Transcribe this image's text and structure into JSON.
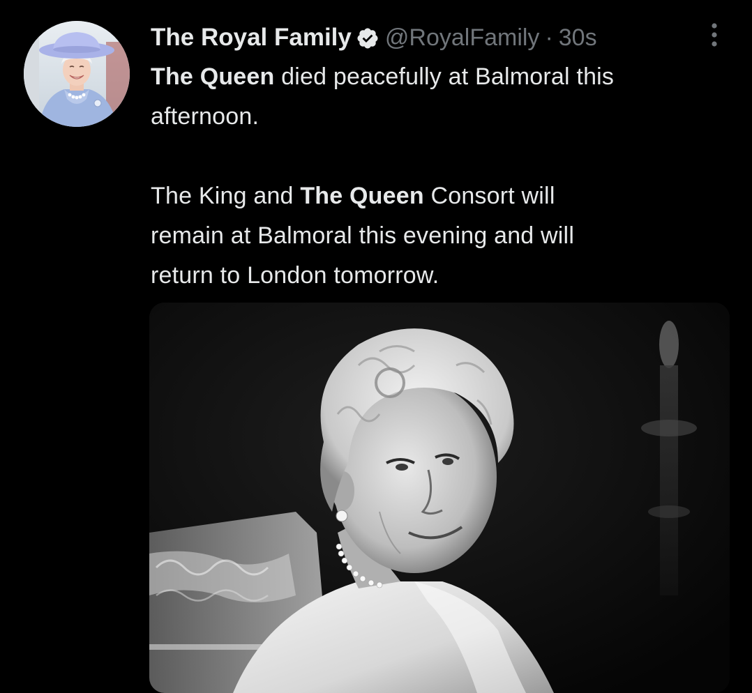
{
  "tweet": {
    "author": {
      "display_name": "The Royal Family",
      "handle": "@RoyalFamily",
      "verified": true,
      "avatar_icon": "profile-photo"
    },
    "separator": "·",
    "timestamp": "30s",
    "more_icon": "more-vertical-icon",
    "text": {
      "para1_bold": "The Queen",
      "para1_rest_line1": " died peacefully at Balmoral this",
      "para1_line2": "afternoon.",
      "para2_line1_a": "The King and ",
      "para2_line1_bold": "The Queen",
      "para2_line1_b": " Consort will",
      "para2_line2": "remain at Balmoral this evening and will",
      "para2_line3": "return to London tomorrow."
    },
    "media": {
      "type": "photo",
      "style": "black-and-white portrait"
    }
  },
  "colors": {
    "background": "#000000",
    "primary_text": "#e7e9ea",
    "secondary_text": "#71767b",
    "badge_fill": "#e7e9ea",
    "badge_check": "#000000"
  }
}
